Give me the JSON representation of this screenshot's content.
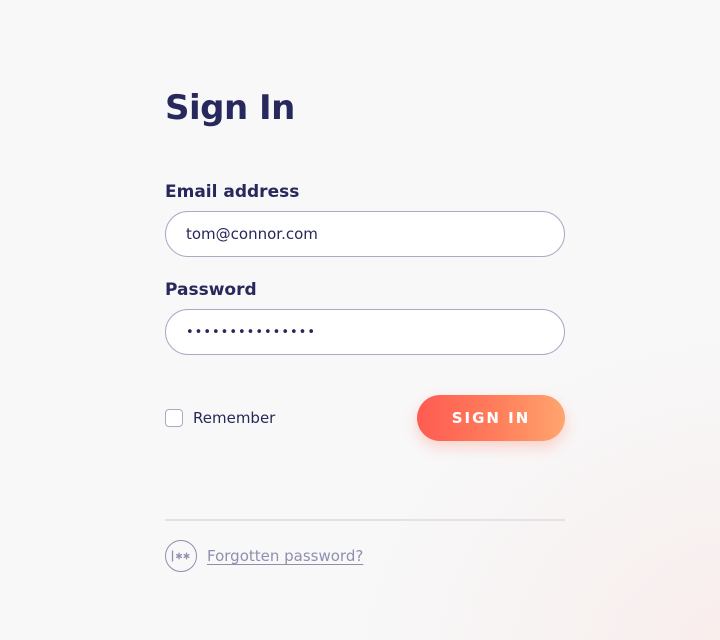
{
  "title": "Sign In",
  "form": {
    "email_label": "Email address",
    "email_value": "tom@connor.com",
    "password_label": "Password",
    "password_value": "•••••••••••••••",
    "remember_label": "Remember",
    "remember_checked": false,
    "submit_label": "SIGN IN"
  },
  "footer": {
    "forgot_label": "Forgotten password?",
    "icon": "password-icon"
  },
  "colors": {
    "text": "#27285b",
    "muted": "#8e8fae",
    "border": "#a9abc6",
    "button_start": "#ff5b52",
    "button_end": "#ffa56e"
  }
}
